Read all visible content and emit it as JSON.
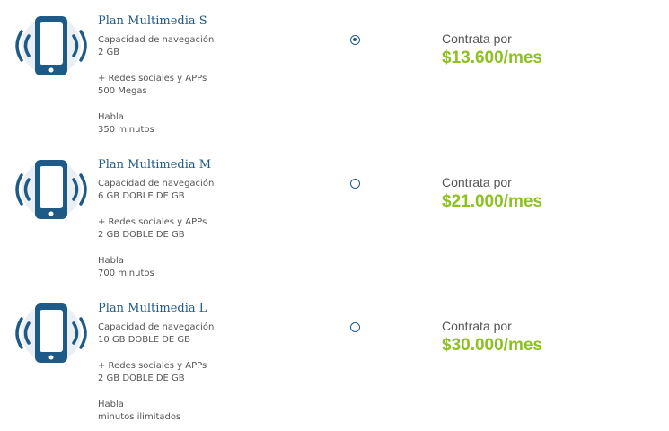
{
  "plans": [
    {
      "title": "Plan Multimedia S",
      "nav_label": "Capacidad de navegación",
      "nav_value": "2 GB",
      "social_label": "+ Redes sociales y APPs",
      "social_value": "500 Megas",
      "talk_label": "Habla",
      "talk_value": "350 minutos",
      "selected": true,
      "price_prefix": "Contrata por",
      "price": "$13.600/mes"
    },
    {
      "title": "Plan Multimedia M",
      "nav_label": "Capacidad de navegación",
      "nav_value": "6 GB DOBLE DE GB",
      "social_label": "+ Redes sociales y APPs",
      "social_value": "2 GB DOBLE DE GB",
      "talk_label": "Habla",
      "talk_value": "700 minutos",
      "selected": false,
      "price_prefix": "Contrata por",
      "price": "$21.000/mes"
    },
    {
      "title": "Plan Multimedia L",
      "nav_label": "Capacidad de navegación",
      "nav_value": "10 GB DOBLE DE GB",
      "social_label": "+ Redes sociales y APPs",
      "social_value": "2 GB DOBLE DE GB",
      "talk_label": "Habla",
      "talk_value": "minutos ilimitados",
      "selected": false,
      "price_prefix": "Contrata por",
      "price": "$30.000/mes"
    }
  ],
  "colors": {
    "accent": "#1e5a87",
    "price": "#8cc21f",
    "text": "#555555"
  },
  "icons": {
    "plan": "phone-vibrating-icon"
  }
}
